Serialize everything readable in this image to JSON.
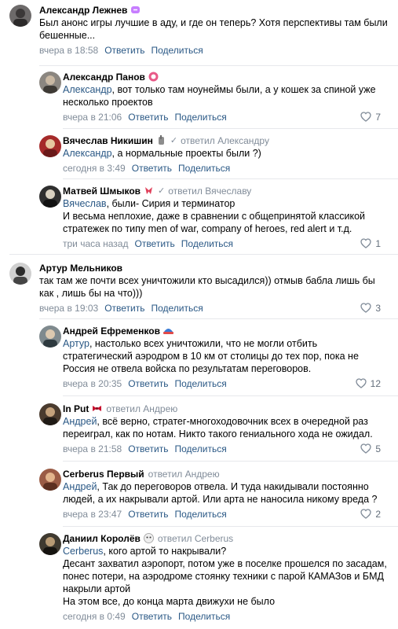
{
  "actions": {
    "reply": "Ответить",
    "share": "Поделиться"
  },
  "colors": {
    "link": "#2a5885",
    "meta": "#818c99",
    "divider": "#e7e8ec"
  },
  "comments": [
    {
      "author": "Александр Лежнев",
      "reply_to": "",
      "mention": "",
      "text_lines": [
        "Был анонс игры лучшие в аду, и где он теперь? Хотя перспективы там были",
        "бешенные..."
      ],
      "time": "вчера в 18:58",
      "likes": "",
      "badge_icon": "sparkle-badge-icon"
    },
    {
      "author": "Александр Панов",
      "reply_to": "",
      "mention": "Александр",
      "text_lines": [
        ", вот только там ноунеймы были, а у кошек за спиной уже",
        "несколько проектов"
      ],
      "time": "вчера в 21:06",
      "likes": "7",
      "badge_icon": "pink-circle-badge-icon"
    },
    {
      "author": "Вячеслав Никишин",
      "reply_to": "ответил Александру",
      "mention": "Александр",
      "text_lines": [
        ", а нормальные проекты были ?)"
      ],
      "time": "сегодня в 3:49",
      "likes": "",
      "badge_icon": "hand-badge-icon"
    },
    {
      "author": "Матвей Шмыков",
      "reply_to": "ответил Вячеславу",
      "mention": "Вячеслав",
      "text_lines": [
        ", были- Сирия и терминатор",
        "И весьма неплохие, даже в сравнении с общепринятой классикой",
        "стратежек по типу men of war, company of heroes, red alert и т.д."
      ],
      "time": "три часа назад",
      "likes": "1",
      "badge_icon": "ribbon-badge-icon"
    },
    {
      "author": "Артур Мельников",
      "reply_to": "",
      "mention": "",
      "text_lines": [
        "так там же почти всех уничтожили кто высадился)) отмыв бабла лишь бы",
        "как , лишь бы на что)))"
      ],
      "time": "вчера в 19:03",
      "likes": "3",
      "badge_icon": ""
    },
    {
      "author": "Андрей Ефременков",
      "reply_to": "",
      "mention": "Артур",
      "text_lines": [
        ", настолько всех уничтожили, что не могли отбить",
        "стратегический аэродром в 10 км от столицы до тех пор, пока не",
        "Россия не отвела войска по результатам переговоров."
      ],
      "time": "вчера в 20:35",
      "likes": "12",
      "badge_icon": "hat-badge-icon"
    },
    {
      "author": "In Put",
      "reply_to": "ответил Андрею",
      "mention": "Андрей",
      "text_lines": [
        ", всё верно, стратег-многоходовочник всех в очередной раз",
        "переиграл, как по нотам. Никто такого гениального хода не ожидал."
      ],
      "time": "вчера в 21:58",
      "likes": "5",
      "badge_icon": "bow-badge-icon"
    },
    {
      "author": "Cerberus Первый",
      "reply_to": "ответил Андрею",
      "mention": "Андрей",
      "text_lines": [
        ", Так до переговоров отвела. И туда накидывали постоянно",
        "людей, а их накрывали артой. Или арта не наносила никому вреда ?"
      ],
      "time": "вчера в 23:47",
      "likes": "2",
      "badge_icon": ""
    },
    {
      "author": "Даниил Королёв",
      "reply_to": "ответил Cerberus",
      "mention": "Cerberus",
      "text_lines": [
        ", кого артой то накрывали?",
        "Десант захватил аэропорт, потом уже в поселке прошелся по засадам,",
        "понес потери, на аэродроме стоянку техники с парой КАМАЗов и БМД",
        "накрыли артой",
        "На этом все, до конца марта движухи не было"
      ],
      "time": "сегодня в 0:49",
      "likes": "",
      "badge_icon": "face-badge-icon"
    }
  ]
}
